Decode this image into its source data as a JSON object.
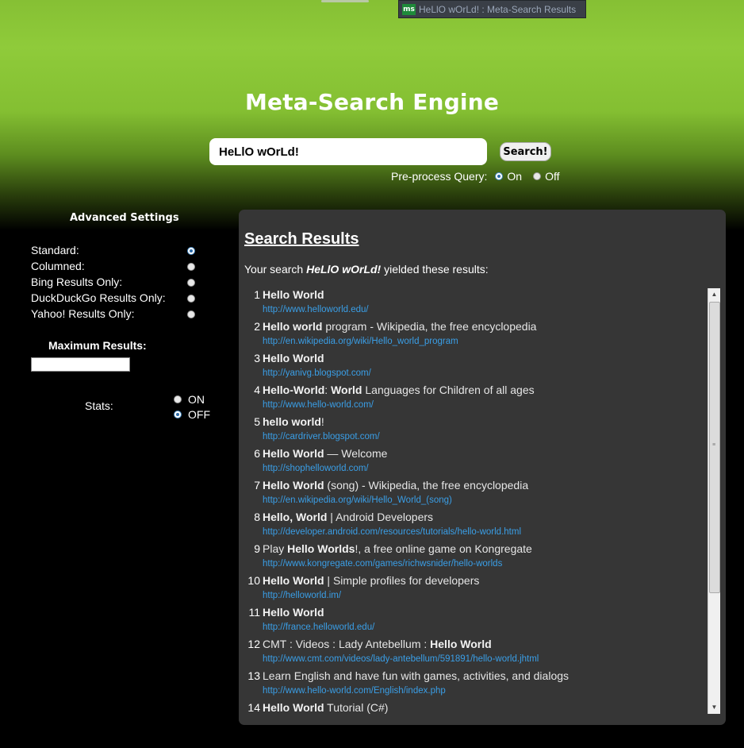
{
  "tab": {
    "logo": "ms",
    "title": "HeLlO wOrLd! : Meta-Search Results"
  },
  "header": {
    "title": "Meta-Search Engine"
  },
  "search": {
    "value": "HeLlO wOrLd!",
    "button": "Search!"
  },
  "preprocess": {
    "label": "Pre-process Query:",
    "on": "On",
    "off": "Off",
    "selected": "On"
  },
  "advanced": {
    "title": "Advanced Settings",
    "options": [
      {
        "label": "Standard:",
        "checked": true
      },
      {
        "label": "Columned:",
        "checked": false
      },
      {
        "label": "Bing Results Only:",
        "checked": false
      },
      {
        "label": "DuckDuckGo Results Only:",
        "checked": false
      },
      {
        "label": "Yahoo! Results Only:",
        "checked": false
      }
    ],
    "max_results_title": "Maximum Results:",
    "max_results_value": "",
    "stats_label": "Stats:",
    "stats_on": "ON",
    "stats_off": "OFF",
    "stats_selected": "OFF"
  },
  "results": {
    "title": "Search Results",
    "summary_prefix": "Your search ",
    "summary_query": "HeLlO wOrLd!",
    "summary_suffix": " yielded these results:",
    "items": [
      {
        "n": "1",
        "bold1": "Hello World",
        "rest": "",
        "url": "http://www.helloworld.edu/"
      },
      {
        "n": "2",
        "bold1": "Hello world",
        "rest": " program - Wikipedia, the free encyclopedia",
        "url": "http://en.wikipedia.org/wiki/Hello_world_program"
      },
      {
        "n": "3",
        "bold1": "Hello World",
        "rest": "",
        "url": "http://yanivg.blogspot.com/"
      },
      {
        "n": "4",
        "bold1": "Hello-World",
        "mid": ": ",
        "bold2": "World",
        "rest": " Languages for Children of all ages",
        "url": "http://www.hello-world.com/"
      },
      {
        "n": "5",
        "bold1": "hello world",
        "rest": "!",
        "url": "http://cardriver.blogspot.com/"
      },
      {
        "n": "6",
        "bold1": "Hello World",
        "rest": " — Welcome",
        "url": "http://shophelloworld.com/"
      },
      {
        "n": "7",
        "bold1": "Hello World",
        "rest": " (song) - Wikipedia, the free encyclopedia",
        "url": "http://en.wikipedia.org/wiki/Hello_World_(song)"
      },
      {
        "n": "8",
        "bold1": "Hello, World",
        "rest": " | Android Developers",
        "url": "http://developer.android.com/resources/tutorials/hello-world.html"
      },
      {
        "n": "9",
        "pre": "Play ",
        "bold1": "Hello Worlds",
        "rest": "!, a free online game on Kongregate",
        "url": "http://www.kongregate.com/games/richwsnider/hello-worlds"
      },
      {
        "n": "10",
        "bold1": "Hello World",
        "rest": " | Simple profiles for developers",
        "url": "http://helloworld.im/"
      },
      {
        "n": "11",
        "bold1": "Hello World",
        "rest": "",
        "url": "http://france.helloworld.edu/"
      },
      {
        "n": "12",
        "pre": "CMT : Videos : Lady Antebellum : ",
        "bold1": "Hello World",
        "rest": "",
        "url": "http://www.cmt.com/videos/lady-antebellum/591891/hello-world.jhtml"
      },
      {
        "n": "13",
        "pre": "Learn English and have fun with games, activities, and dialogs",
        "bold1": "",
        "rest": "",
        "url": "http://www.hello-world.com/English/index.php"
      },
      {
        "n": "14",
        "bold1": "Hello World",
        "rest": " Tutorial (C#)",
        "url": ""
      }
    ]
  },
  "icons": {
    "scroll_up": "▲",
    "scroll_down": "▼",
    "grip": "≡"
  }
}
